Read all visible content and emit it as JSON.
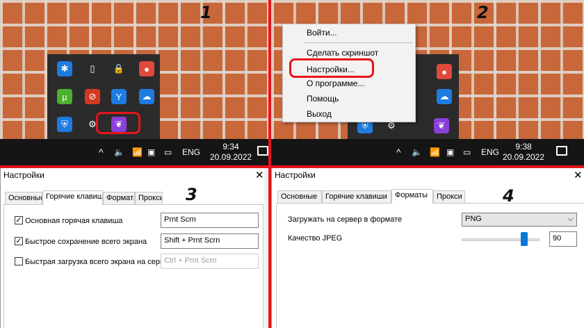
{
  "panel1": {
    "number": "1",
    "taskbar": {
      "lang": "ENG",
      "time": "9:34",
      "date": "20.09.2022",
      "chevron": "^"
    },
    "tray_icons": [
      {
        "name": "bluetooth-icon",
        "color": "#1e7be0",
        "glyph": "✱"
      },
      {
        "name": "usb-drive-icon",
        "color": "#2b2b2b",
        "glyph": "▯"
      },
      {
        "name": "lock-sync-icon",
        "color": "#2b2b2b",
        "glyph": "🔒"
      },
      {
        "name": "app-badge-icon",
        "color": "#e0493b",
        "glyph": "●"
      },
      {
        "name": "utorrent-icon",
        "color": "#4caf2d",
        "glyph": "µ"
      },
      {
        "name": "usb-red-icon",
        "color": "#d23a1f",
        "glyph": "⊘"
      },
      {
        "name": "yandex-disk-icon",
        "color": "#1e7be0",
        "glyph": "Y"
      },
      {
        "name": "cloud-icon",
        "color": "#1e7be0",
        "glyph": "☁"
      },
      {
        "name": "defender-icon",
        "color": "#1e7be0",
        "glyph": "⛨"
      },
      {
        "name": "settings-gear-icon",
        "color": "#2b2b2b",
        "glyph": "⚙"
      },
      {
        "name": "feather-icon",
        "color": "#8a3fd8",
        "glyph": "❦"
      }
    ]
  },
  "panel2": {
    "number": "2",
    "menu": {
      "items": [
        "Войти...",
        "Сделать скриншот",
        "Настройки...",
        "О программе...",
        "Помощь",
        "Выход"
      ]
    },
    "taskbar": {
      "lang": "ENG",
      "time": "9:38",
      "date": "20.09.2022",
      "chevron": "^"
    }
  },
  "panel3": {
    "number": "3",
    "title": "Настройки",
    "close": "✕",
    "tabs": [
      "Основные",
      "Горячие клавиши",
      "Форматы",
      "Прокси"
    ],
    "active_tab": 1,
    "rows": [
      {
        "checked": true,
        "label": "Основная горячая клавиша",
        "value": "Prnt Scrn",
        "disabled": false
      },
      {
        "checked": true,
        "label": "Быстрое сохранение всего экрана",
        "value": "Shift + Prnt Scrn",
        "disabled": false
      },
      {
        "checked": false,
        "label": "Быстрая загрузка всего экрана на сервер",
        "value": "Ctrl + Prnt Scrn",
        "disabled": true
      }
    ]
  },
  "panel4": {
    "number": "4",
    "title": "Настройки",
    "close": "✕",
    "tabs": [
      "Основные",
      "Горячие клавиши",
      "Форматы",
      "Прокси"
    ],
    "active_tab": 2,
    "format_label": "Загружать на сервер в формате",
    "format_value": "PNG",
    "quality_label": "Качество JPEG",
    "quality_value": "90",
    "quality_slider_fraction": 0.8
  }
}
